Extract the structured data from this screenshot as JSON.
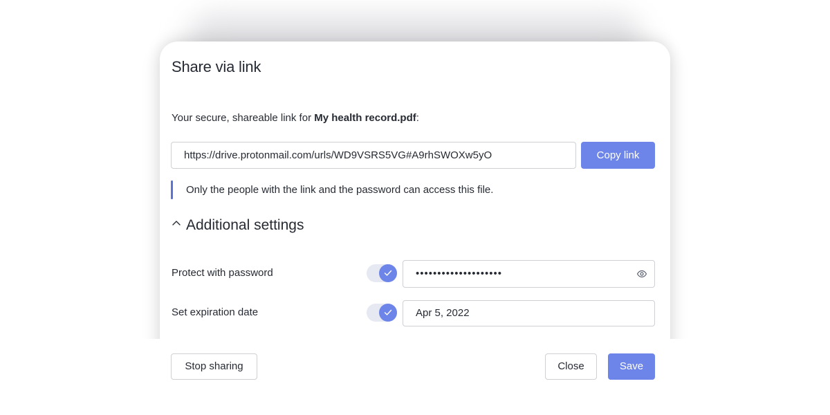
{
  "dialog": {
    "title": "Share via link",
    "intro_prefix": "Your secure, shareable link for ",
    "file_name": "My health record.pdf",
    "intro_suffix": ":",
    "link_value": "https://drive.protonmail.com/urls/WD9VSRS5VG#A9rhSWOXw5yO",
    "copy_button": "Copy link",
    "notice": "Only the people with the link and the password can access this file."
  },
  "settings": {
    "header": "Additional settings",
    "expanded": true,
    "password": {
      "label": "Protect with password",
      "enabled": true,
      "masked_value": "••••••••••••••••••••",
      "icon": "eye-icon"
    },
    "expiration": {
      "label": "Set expiration date",
      "enabled": true,
      "value": "Apr 5, 2022"
    }
  },
  "footer": {
    "stop_sharing": "Stop sharing",
    "close": "Close",
    "save": "Save"
  },
  "colors": {
    "accent": "#6d85e8",
    "notice_bar": "#5c73d6",
    "text": "#262a33",
    "border": "#cfcfd4"
  }
}
